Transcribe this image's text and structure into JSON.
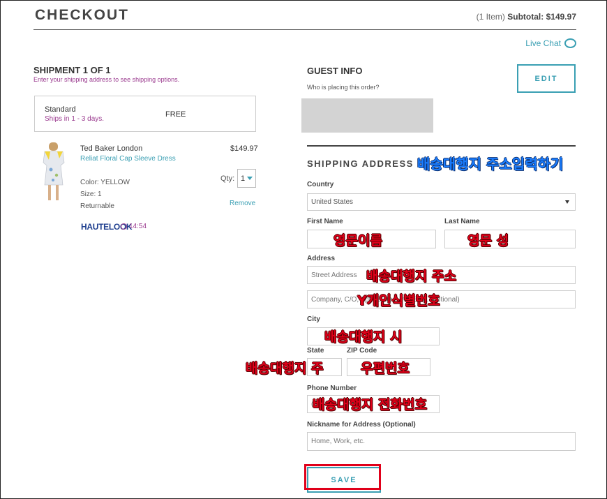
{
  "header": {
    "title": "CHECKOUT",
    "item_count": "(1 Item)",
    "subtotal_label": "Subtotal:",
    "subtotal_value": "$149.97",
    "live_chat": "Live Chat"
  },
  "shipment": {
    "title": "SHIPMENT 1 OF 1",
    "subtitle": "Enter your shipping address to see shipping options.",
    "option_name": "Standard",
    "option_days": "Ships in 1 - 3 days.",
    "option_price": "FREE"
  },
  "product": {
    "brand": "Ted Baker London",
    "name": "Reliat Floral Cap Sleeve Dress",
    "price": "$149.97",
    "color": "Color: YELLOW",
    "size": "Size: 1",
    "returnable": "Returnable",
    "qty_label": "Qty:",
    "qty_value": "1",
    "remove": "Remove",
    "store": "HAUTELOOK",
    "timer": "14:54"
  },
  "guest": {
    "title": "GUEST INFO",
    "subtitle": "Who is placing this order?",
    "edit_label": "EDIT"
  },
  "shipping": {
    "title": "SHIPPING ADDRESS",
    "country_label": "Country",
    "country_value": "United States",
    "first_name_label": "First Name",
    "last_name_label": "Last Name",
    "address_label": "Address",
    "street_placeholder": "Street Address",
    "company_placeholder": "Company, C/O, Apt., Suite, Unit, Bldg. (optional)",
    "city_label": "City",
    "state_label": "State",
    "zip_label": "ZIP Code",
    "phone_label": "Phone Number",
    "phone_placeholder": "(",
    "nickname_label": "Nickname for Address (Optional)",
    "nickname_placeholder": "Home, Work, etc.",
    "save_label": "SAVE"
  },
  "annotations": {
    "shipping_address": "배송대행지 주소입력하기",
    "first_name": "영문이름",
    "last_name": "영문 성",
    "street": "배송대행지 주소",
    "company": "Y개인식별번호",
    "city": "배송대행지 시",
    "state": "배송대행지 주",
    "zip": "우편번호",
    "phone": "배송대행지 전화번호"
  },
  "colors": {
    "accent": "#3a9fb3",
    "purple": "#9b3b8f",
    "annotation_red": "#e0001a",
    "annotation_blue": "#1a7dff"
  }
}
